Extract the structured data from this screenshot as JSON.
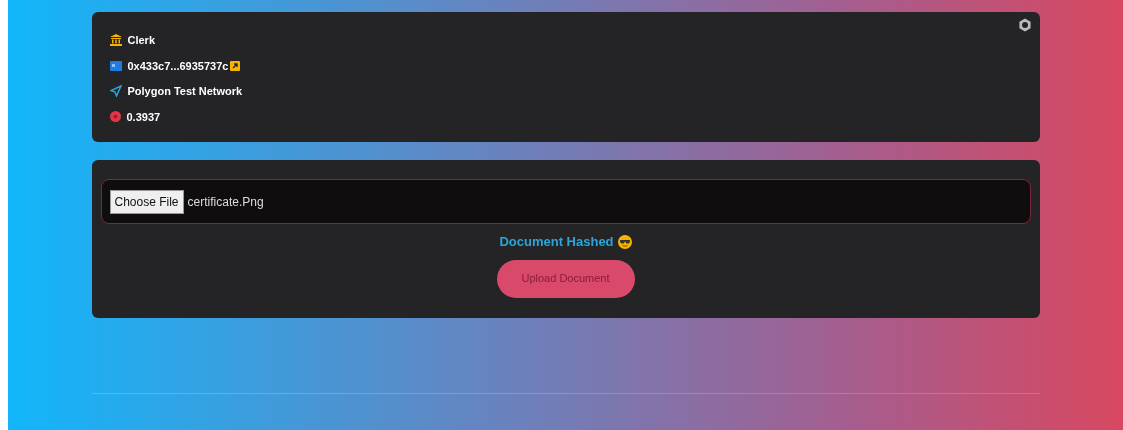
{
  "account": {
    "role": "Clerk",
    "address": "0x433c7...6935737c",
    "network": "Polygon Test Network",
    "balance": "0.3937"
  },
  "upload": {
    "file_button": "Choose File",
    "file_name": "certificate.Png",
    "status": "Document Hashed",
    "button": "Upload Document"
  }
}
